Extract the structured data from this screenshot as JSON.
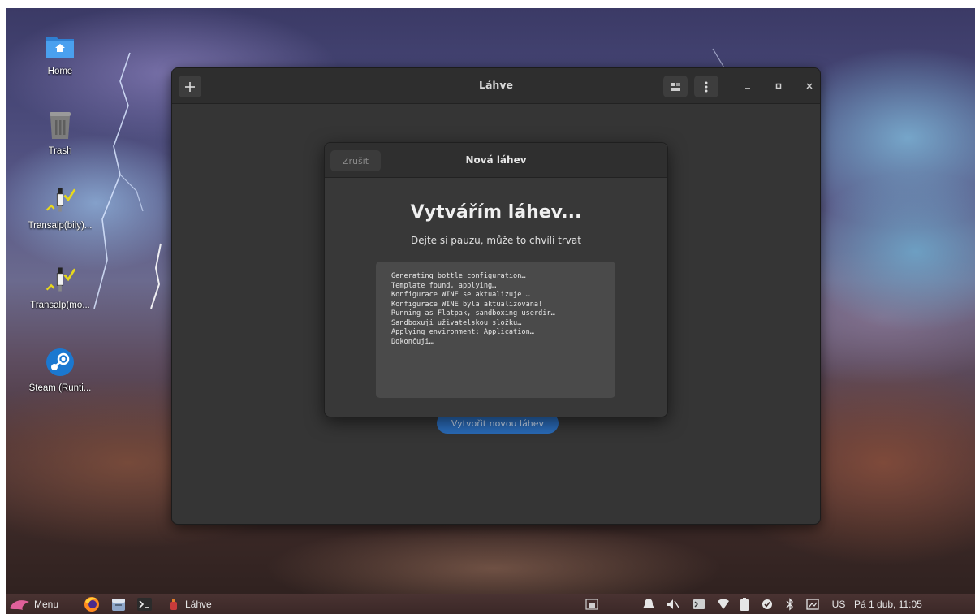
{
  "desktop": {
    "icons": [
      {
        "label": "Home",
        "icon": "home-folder-icon"
      },
      {
        "label": "Trash",
        "icon": "trash-icon"
      },
      {
        "label": "Transalp(bily)...",
        "icon": "transalp-icon"
      },
      {
        "label": "Transalp(mo...",
        "icon": "transalp-icon"
      },
      {
        "label": "Steam (Runti...",
        "icon": "steam-icon"
      }
    ]
  },
  "window": {
    "title": "Láhve",
    "create_button": "Vytvořit novou láhev"
  },
  "dialog": {
    "cancel_label": "Zrušit",
    "title": "Nová láhev",
    "heading": "Vytvářím láhev...",
    "subtitle": "Dejte si pauzu, může to chvíli trvat",
    "log_lines": [
      "Generating bottle configuration…",
      "Template found, applying…",
      "Konfigurace WINE se aktualizuje …",
      "Konfigurace WINE byla aktualizována!",
      "Running as Flatpak, sandboxing userdir…",
      "Sandboxuji uživatelskou složku…",
      "Applying environment: Application…",
      "Dokončuji…"
    ]
  },
  "taskbar": {
    "menu_label": "Menu",
    "task_label": "Láhve",
    "keyboard_layout": "US",
    "clock": "Pá 1 dub, 11:05"
  },
  "colors": {
    "accent": "#2a6bb8",
    "window_bg": "#353535",
    "dialog_bg": "#383838",
    "taskbar_bg": "#3b2827"
  }
}
